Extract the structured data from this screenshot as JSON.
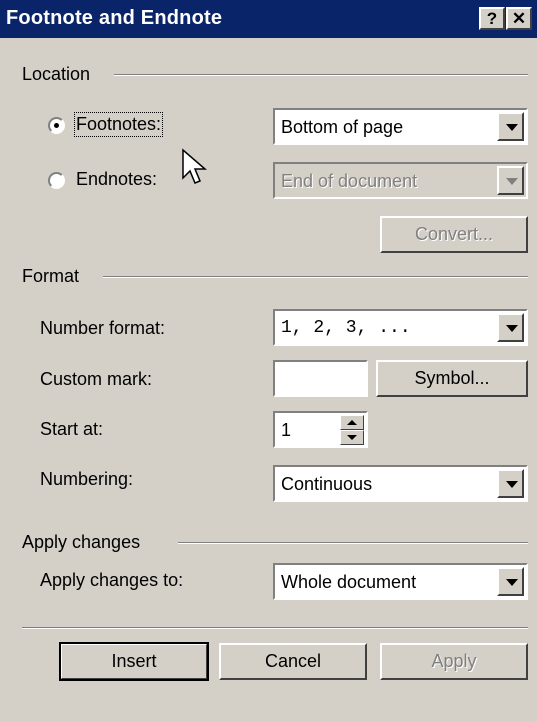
{
  "window": {
    "title": "Footnote and Endnote",
    "help_label": "?",
    "close_label": "✕"
  },
  "location": {
    "group_label": "Location",
    "footnotes": {
      "label": "Footnotes:",
      "selected": true,
      "position_value": "Bottom of page"
    },
    "endnotes": {
      "label": "Endnotes:",
      "selected": false,
      "position_value": "End of document"
    },
    "convert_label": "Convert..."
  },
  "format": {
    "group_label": "Format",
    "number_format_label": "Number format:",
    "number_format_value": "1, 2, 3, ...",
    "custom_mark_label": "Custom mark:",
    "custom_mark_value": "",
    "symbol_label": "Symbol...",
    "start_at_label": "Start at:",
    "start_at_value": "1",
    "numbering_label": "Numbering:",
    "numbering_value": "Continuous"
  },
  "apply_changes": {
    "group_label": "Apply changes",
    "apply_to_label": "Apply changes to:",
    "apply_to_value": "Whole document"
  },
  "buttons": {
    "insert": "Insert",
    "cancel": "Cancel",
    "apply": "Apply"
  }
}
